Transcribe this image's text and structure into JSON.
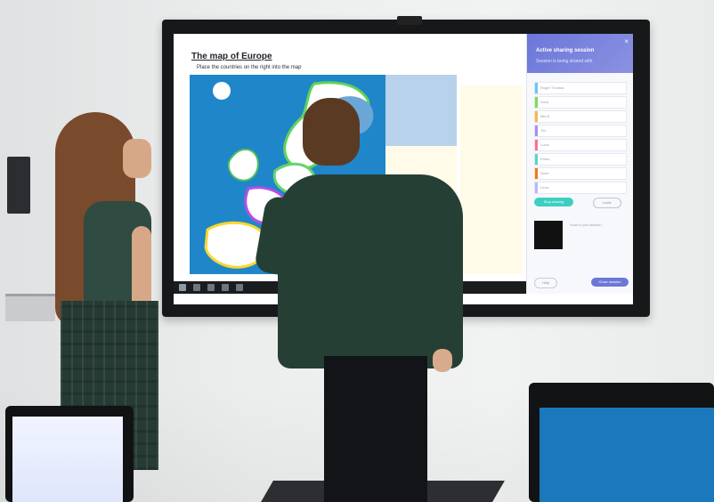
{
  "screen": {
    "title": "The map of Europe",
    "subtitle": "Place the countries on the right into the map"
  },
  "panel": {
    "title": "Active sharing session",
    "subtitle": "Session is being shared with",
    "close": "×",
    "users": [
      {
        "label": "Roger Thomas",
        "color": "#66c6ff"
      },
      {
        "label": "Anna",
        "color": "#7ed957"
      },
      {
        "label": "Mia B.",
        "color": "#ffb347"
      },
      {
        "label": "Tim",
        "color": "#a78bfa"
      },
      {
        "label": "Lucia",
        "color": "#ff6f91"
      },
      {
        "label": "Ethan",
        "color": "#5ad3c7"
      },
      {
        "label": "Noah",
        "color": "#f97316"
      },
      {
        "label": "Lena",
        "color": "#b5b7ff"
      }
    ],
    "btn_primary": "Stop sharing",
    "btn_secondary": "Invite",
    "qr_note": "Scan to join session",
    "btn_left": "Help",
    "btn_right": "Close session"
  },
  "colors": {
    "panel_header": "#6d77d6",
    "accent_green": "#3ccfc0",
    "map_sea": "#1f86c9",
    "right_zone": "#fffbe8"
  }
}
